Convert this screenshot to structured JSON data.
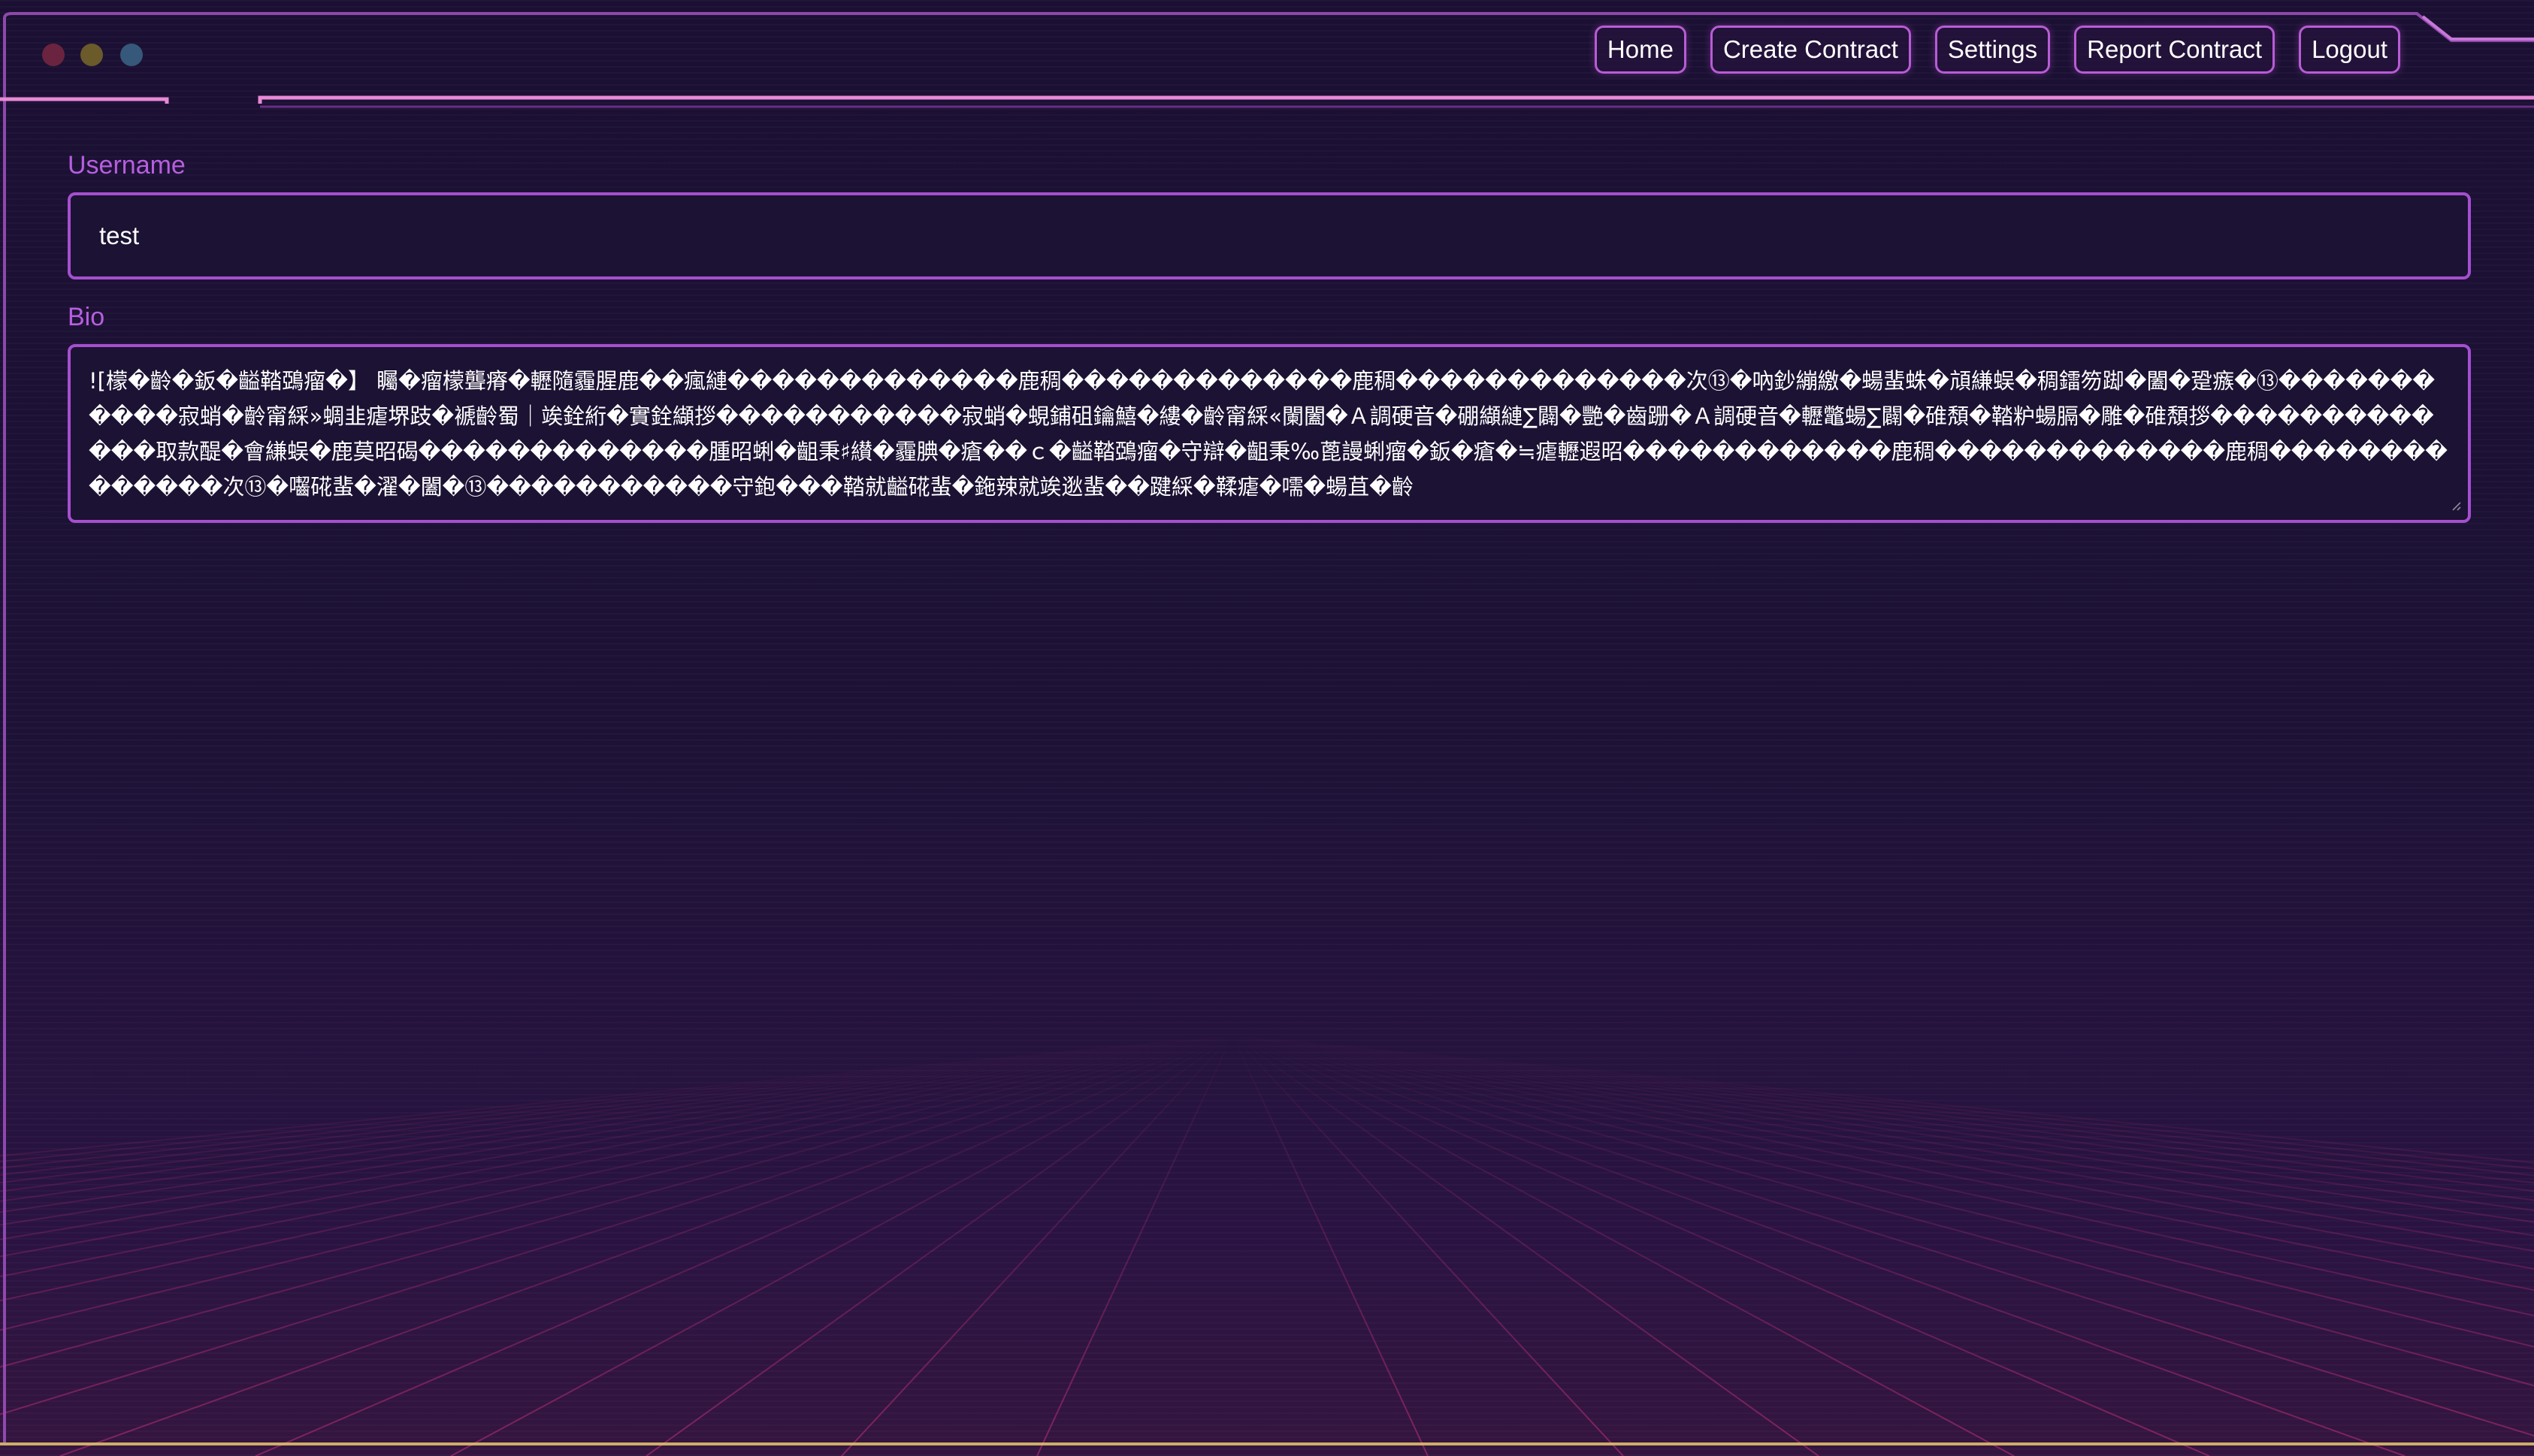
{
  "window": {
    "controls": [
      "close",
      "minimize",
      "zoom"
    ]
  },
  "nav": {
    "items": [
      {
        "label": "Home"
      },
      {
        "label": "Create Contract"
      },
      {
        "label": "Settings"
      },
      {
        "label": "Report Contract"
      },
      {
        "label": "Logout"
      }
    ]
  },
  "form": {
    "username_label": "Username",
    "username_value": "test",
    "bio_label": "Bio",
    "bio_value": "![檬�齡�鈑�齸鞜鵶瘤�】 矚�瘤檬聾瘠�轣隨霾腥鹿��瘋縺�������������鹿稠�������������鹿稠�������������次⑬�吶鈔繃繳�蝪蜚蛛�頏縑蜈�稠鐳笏踋�闔�跫瘯�⑬�����������寂蛸�齡甯綵»蜩韭瘧堺跂�褫齡蜀｜竢銓絎�實銓纈拶�����������寂蛸�蜆鋪砠鑰鱚�縷�齡甯綵«闌闔�Ａ調硬音�硼纈縺∑闢�艷�齒跚�Ａ調硬音�轣鼈蝪∑闢�碓頽�鞜粐蝪膈�雕�碓頽拶�������������取款醍�會縑蜈�鹿莫昭碣�������������腫昭蜊�齟秉♯纉�霾腆�瘡��ｃ�齸鞜鵶瘤�守辯�齟秉‰蓖謾蜊瘤�鈑�瘡�≒瘧轣遐昭������������鹿稠�������������鹿稠��������������次⑬�囓硴蜚�濯�闔�⑬�����������守鉋���鞜就齸硴蜚�鉇辣就竢逖蜚��踺綵�鞣瘧�嚅�蝪苴�齡"
  },
  "colors": {
    "accent": "#b75ee0",
    "border": "#a54fd0",
    "background": "#1c1233",
    "frame_glow": "#e07ac8"
  }
}
